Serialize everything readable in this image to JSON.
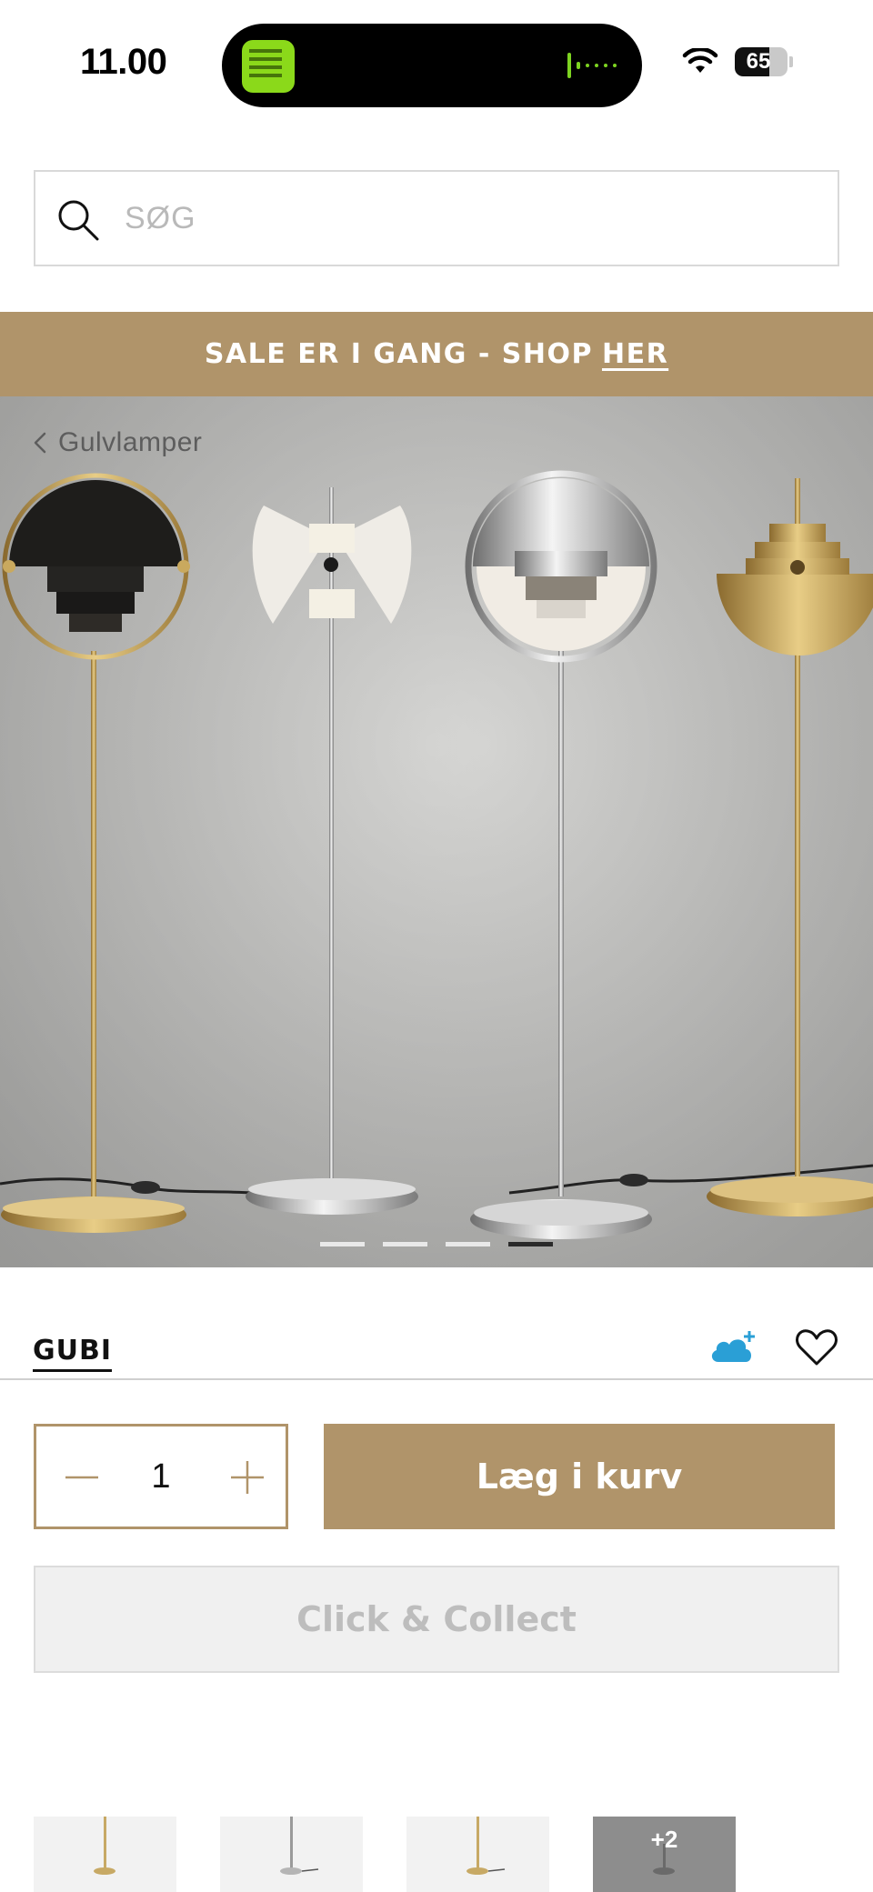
{
  "status_bar": {
    "time": "11.00",
    "battery": "65",
    "battery_level": 0.65,
    "icons": [
      "wifi-icon",
      "battery-icon"
    ]
  },
  "search": {
    "placeholder": "SØG",
    "value": ""
  },
  "banner": {
    "text": "SALE ER I GANG - SHOP",
    "link": "HER"
  },
  "breadcrumb": {
    "label": "Gulvlamper"
  },
  "gallery": {
    "image_count": 4,
    "active_index": 3
  },
  "product": {
    "brand": "GUBI"
  },
  "purchase": {
    "quantity": "1",
    "add_to_cart_label": "Læg i kurv",
    "click_collect_label": "Click & Collect"
  },
  "thumbnails": {
    "more_label": "+2"
  },
  "colors": {
    "accent": "#b0946a",
    "cloud": "#2a9fd6",
    "disabled_bg": "#f0f0f0",
    "disabled_text": "#bdbdbd"
  }
}
